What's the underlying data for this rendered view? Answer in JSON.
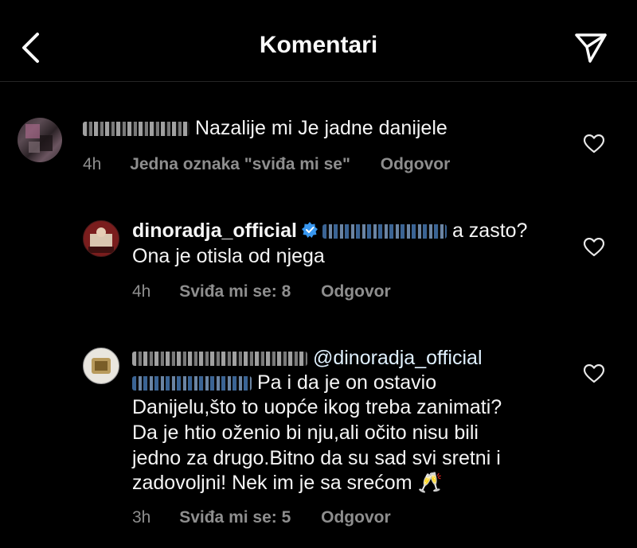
{
  "header": {
    "title": "Komentari"
  },
  "comments": [
    {
      "text": "Nazalije mi Je jadne danijele",
      "time": "4h",
      "likes": "Jedna oznaka \"sviđa mi se\"",
      "reply": "Odgovor"
    },
    {
      "username": "dinoradja_official",
      "text_line1": "a zasto?",
      "text_line2": "Ona je otisla od njega",
      "time": "4h",
      "likes": "Sviđa mi se: 8",
      "reply": "Odgovor"
    },
    {
      "mention": "@dinoradja_official",
      "text_line1": "Pa i da je on ostavio",
      "text_line2": "Danijelu,što to uopće ikog treba zanimati?",
      "text_line3": "Da je htio oženio bi nju,ali očito nisu bili",
      "text_line4": "jedno za drugo.Bitno da su sad svi sretni i",
      "text_line5": "zadovoljni! Nek im je sa srećom 🥂",
      "time": "3h",
      "likes": "Sviđa mi se: 5",
      "reply": "Odgovor"
    }
  ],
  "icons": {
    "back": "chevron-left-icon",
    "share": "paper-plane-icon",
    "like": "heart-outline-icon",
    "verified": "verified-badge-icon"
  },
  "colors": {
    "background": "#000000",
    "text": "#f5f5f5",
    "meta": "#8e8e8e",
    "verified": "#3897f0",
    "mention": "#e0f1ff"
  }
}
